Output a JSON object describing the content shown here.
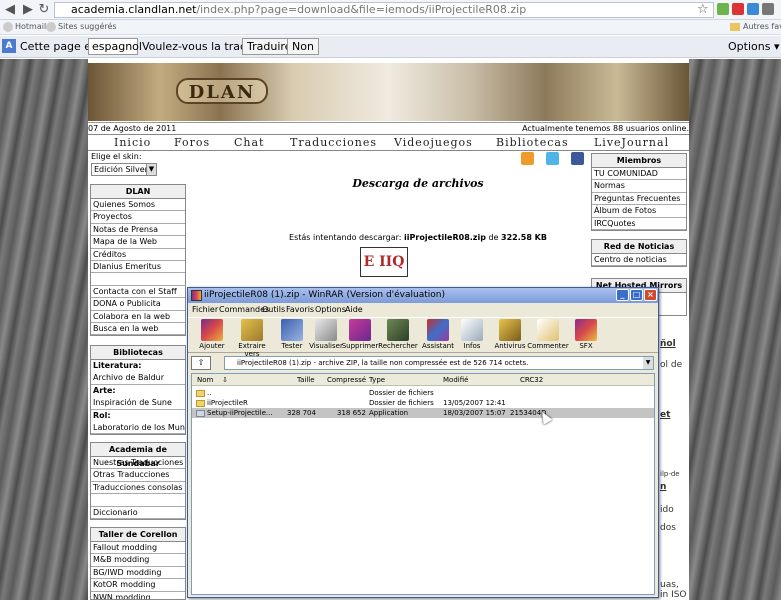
{
  "browser": {
    "url_host": "academia.clandlan.net",
    "url_rest": "/index.php?page=download&file=iemods/iiProjectileR08.zip",
    "bookmarks": [
      "Hotmail",
      "Sites suggérés",
      "Autres favoris"
    ],
    "translate": {
      "prefix": "Cette page est en",
      "language": "espagnol",
      "question": "Voulez-vous la traduire ?",
      "translate_btn": "Traduire",
      "no_btn": "Non",
      "options": "Options"
    }
  },
  "site": {
    "logo": "DLAN",
    "date": "07 de Agosto de 2011",
    "online": "Actualmente tenemos 88 usuarios online.",
    "nav": [
      "Inicio",
      "Foros",
      "Chat",
      "Traducciones",
      "Videojuegos",
      "Bibliotecas",
      "LiveJournal"
    ],
    "skin_label": "Elige el skin:",
    "skin_value": "Edición Silver",
    "dlan_box": {
      "title": "DLAN",
      "items": [
        "Quienes Somos",
        "Proyectos",
        "Notas de Prensa",
        "Mapa de la Web",
        "Créditos",
        "Dlanius Emeritus",
        "",
        "Contacta con el Staff",
        "DONA o Publicita",
        "Colabora en la web",
        "Busca en la web"
      ]
    },
    "bibliotecas_box": {
      "title": "Bibliotecas",
      "items": [
        {
          "label": "Literatura:",
          "bold": true
        },
        {
          "label": "Archivo de Baldur",
          "bold": false
        },
        {
          "label": "Arte:",
          "bold": true
        },
        {
          "label": "Inspiración de Sune",
          "bold": false
        },
        {
          "label": "Rol:",
          "bold": true
        },
        {
          "label": "Laboratorio de los Mundos",
          "bold": false
        }
      ]
    },
    "sundabar_box": {
      "title": "Academia de Sundabar",
      "items": [
        "Nuestras Traducciones",
        "Otras Traducciones",
        "Traducciones consolas",
        "",
        "Diccionario"
      ]
    },
    "corellon_box": {
      "title": "Taller de Corellon",
      "items": [
        "Fallout modding",
        "M&B modding",
        "BG/IWD modding",
        "KotOR modding",
        "NWN modding"
      ]
    },
    "download_title": "Descarga de archivos",
    "download_prefix": "Estás intentando descargar:",
    "download_file": "iiProjectileR08.zip",
    "download_of": "de",
    "download_size": "322.58 KB",
    "download_logo": "E IIQ",
    "miembros_box": {
      "title": "Miembros",
      "items": [
        "TU COMUNIDAD",
        "Normas",
        "Preguntas Frecuentes",
        "Álbum de Fotos",
        "IRCQuotes"
      ]
    },
    "noticias_box": {
      "title": "Red de Noticias",
      "items": [
        "Centro de noticias"
      ]
    },
    "net_row": "Net  Hosted  Mirrors",
    "right_trail": [
      "ñol",
      "ol de",
      "et",
      "ilp-de",
      "n",
      "ido",
      "dos",
      "uas,",
      "in ISO"
    ]
  },
  "winrar": {
    "title": "iiProjectileR08 (1).zip - WinRAR (Version d'évaluation)",
    "menu": [
      "Fichier",
      "Commandes",
      "Outils",
      "Favoris",
      "Options",
      "Aide"
    ],
    "tools": [
      "Ajouter",
      "Extraire vers",
      "Tester",
      "Visualiser",
      "Supprimer",
      "Rechercher",
      "Assistant",
      "Infos",
      "Antivirus",
      "Commenter",
      "SFX"
    ],
    "path": "iiProjectileR08 (1).zip - archive ZIP, la taille non compressée est de 526 714 octets.",
    "columns": [
      "Nom",
      "Taille",
      "Compressé",
      "Type",
      "Modifié",
      "CRC32"
    ],
    "rows": [
      {
        "name": "..",
        "size": "",
        "packed": "",
        "type": "Dossier de fichiers",
        "modified": "",
        "crc": ""
      },
      {
        "name": "iiProjectileR",
        "size": "",
        "packed": "",
        "type": "Dossier de fichiers",
        "modified": "13/05/2007 12:41",
        "crc": ""
      },
      {
        "name": "Setup-iiProjectile...",
        "size": "328 704",
        "packed": "318 652",
        "type": "Application",
        "modified": "18/03/2007 15:07",
        "crc": "2153404D"
      }
    ]
  }
}
